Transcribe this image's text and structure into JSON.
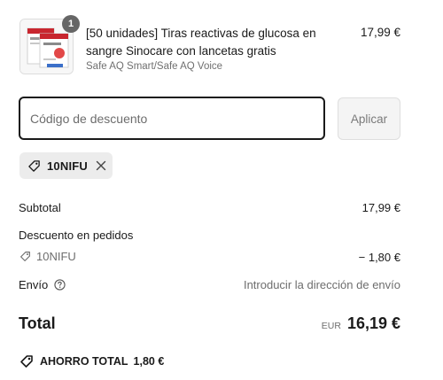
{
  "line_item": {
    "quantity": "1",
    "title": "[50 unidades] Tiras reactivas de glucosa en sangre Sinocare con lancetas gratis",
    "variant": "Safe AQ Smart/Safe AQ Voice",
    "price": "17,99 €",
    "image_icon": "product-box-image"
  },
  "discount": {
    "placeholder": "Código de descuento",
    "value": "",
    "apply_label": "Aplicar",
    "applied_code": "10NIFU"
  },
  "summary": {
    "subtotal_label": "Subtotal",
    "subtotal_value": "17,99 €",
    "order_discount_label": "Descuento en pedidos",
    "order_discount_code": "10NIFU",
    "order_discount_value": "− 1,80 €",
    "shipping_label": "Envío",
    "shipping_value": "Introducir la dirección de envío",
    "total_label": "Total",
    "currency": "EUR",
    "total_value": "16,19 €",
    "savings_label": "AHORRO TOTAL",
    "savings_value": "1,80 €"
  },
  "colors": {
    "text": "#1a1a1a",
    "muted": "#6d6d6d",
    "chip_bg": "#ececec",
    "badge_bg": "#666666",
    "button_bg": "#f4f4f4"
  }
}
